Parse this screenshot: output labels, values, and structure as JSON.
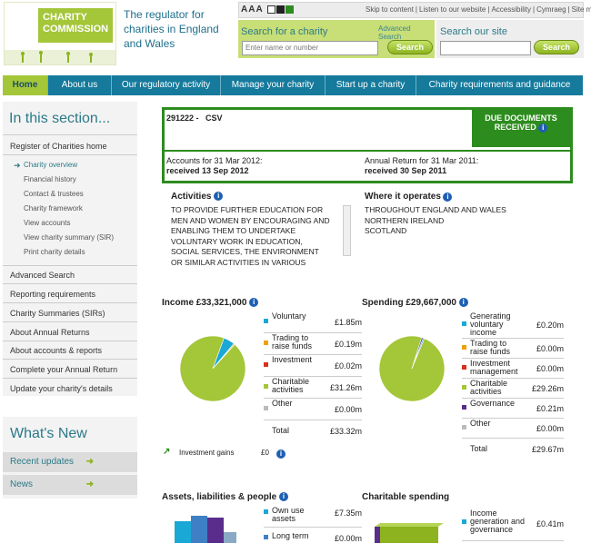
{
  "header": {
    "logo_line1": "CHARITY",
    "logo_line2": "COMMISSION",
    "tagline_1": "The regulator for",
    "tagline_2": "charities in England",
    "tagline_3": "and Wales",
    "text_size": "AAA",
    "links": [
      "Skip to content",
      "Listen to our website",
      "Accessibility",
      "Cymraeg",
      "Site map"
    ],
    "search_charity_label": "Search for a charity",
    "advanced_search": "Advanced Search",
    "search_placeholder": "Enter name or number",
    "search_button": "Search",
    "search_site_label": "Search our site",
    "search_site_button": "Search"
  },
  "nav": {
    "items": [
      "Home",
      "About us",
      "Our regulatory activity",
      "Manage your charity",
      "Start up a charity",
      "Charity requirements and guidance"
    ]
  },
  "sidebar": {
    "title": "In this section...",
    "register": "Register of Charities home",
    "subs": [
      "Charity overview",
      "Financial history",
      "Contact & trustees",
      "Charity framework",
      "View accounts",
      "View charity summary (SIR)",
      "Print charity details"
    ],
    "items": [
      "Advanced Search",
      "Reporting requirements",
      "Charity Summaries (SIRs)",
      "About Annual Returns",
      "About accounts & reports",
      "Complete your Annual Return",
      "Update your charity's details"
    ]
  },
  "whatsnew": {
    "title": "What's New",
    "items": [
      "Recent updates",
      "News"
    ]
  },
  "charity": {
    "number": "291222 -",
    "name": "CSV",
    "due_1": "DUE DOCUMENTS",
    "due_2": "RECEIVED",
    "accounts_label": "Accounts for 31 Mar 2012:",
    "accounts_value": "received 13 Sep 2012",
    "return_label": "Annual Return for 31 Mar 2011:",
    "return_value": "received 30 Sep 2011"
  },
  "activities": {
    "title": "Activities",
    "lines": [
      "TO PROVIDE FURTHER EDUCATION FOR",
      "MEN AND WOMEN BY ENCOURAGING AND",
      "ENABLING THEM TO UNDERTAKE",
      "VOLUNTARY WORK IN EDUCATION,",
      "SOCIAL SERVICES, THE ENVIRONMENT",
      "OR SIMILAR ACTIVITIES IN VARIOUS"
    ]
  },
  "where": {
    "title": "Where it operates",
    "lines": [
      "THROUGHOUT ENGLAND AND WALES",
      "NORTHERN IRELAND",
      "SCOTLAND"
    ]
  },
  "income": {
    "title": "Income £33,321,000",
    "rows": [
      {
        "l1": "Voluntary",
        "l2": "",
        "amt": "£1.85m",
        "color": "#1aa8d6"
      },
      {
        "l1": "Trading to",
        "l2": "raise funds",
        "amt": "£0.19m",
        "color": "#f0a000"
      },
      {
        "l1": "Investment",
        "l2": "",
        "amt": "£0.02m",
        "color": "#d9301c"
      },
      {
        "l1": "Charitable",
        "l2": "activities",
        "amt": "£31.26m",
        "color": "#a4c639"
      },
      {
        "l1": "Other",
        "l2": "",
        "amt": "£0.00m",
        "color": "#bbbbbb"
      }
    ],
    "total_label": "Total",
    "total": "£33.32m"
  },
  "spending": {
    "title": "Spending £29,667,000",
    "rows": [
      {
        "l1": "Generating",
        "l2": "voluntary",
        "l3": "income",
        "amt": "£0.20m",
        "color": "#1aa8d6"
      },
      {
        "l1": "Trading to",
        "l2": "raise funds",
        "l3": "",
        "amt": "£0.00m",
        "color": "#f0a000"
      },
      {
        "l1": "Investment",
        "l2": "management",
        "l3": "",
        "amt": "£0.00m",
        "color": "#d9301c"
      },
      {
        "l1": "Charitable",
        "l2": "activities",
        "l3": "",
        "amt": "£29.26m",
        "color": "#a4c639"
      },
      {
        "l1": "Governance",
        "l2": "",
        "l3": "",
        "amt": "£0.21m",
        "color": "#5a2d8c"
      },
      {
        "l1": "Other",
        "l2": "",
        "l3": "",
        "amt": "£0.00m",
        "color": "#bbbbbb"
      }
    ],
    "total_label": "Total",
    "total": "£29.67m"
  },
  "investment_gains": {
    "label": "Investment gains",
    "value": "£0"
  },
  "assets": {
    "title": "Assets, liabilities & people",
    "rows": [
      {
        "l1": "Own use",
        "l2": "assets",
        "amt": "£7.35m"
      },
      {
        "l1": "Long term",
        "l2": "",
        "amt": "£0.00m"
      }
    ]
  },
  "charitable_spending": {
    "title": "Charitable spending",
    "rows": [
      {
        "l1": "Income",
        "l2": "generation and",
        "l3": "governance",
        "amt": "£0.41m"
      }
    ]
  },
  "chart_data": [
    {
      "type": "pie",
      "title": "Income £33,321,000",
      "categories": [
        "Voluntary",
        "Trading to raise funds",
        "Investment",
        "Charitable activities",
        "Other"
      ],
      "values": [
        1.85,
        0.19,
        0.02,
        31.26,
        0.0
      ]
    },
    {
      "type": "pie",
      "title": "Spending £29,667,000",
      "categories": [
        "Generating voluntary income",
        "Trading to raise funds",
        "Investment management",
        "Charitable activities",
        "Governance",
        "Other"
      ],
      "values": [
        0.2,
        0.0,
        0.0,
        29.26,
        0.21,
        0.0
      ]
    }
  ]
}
